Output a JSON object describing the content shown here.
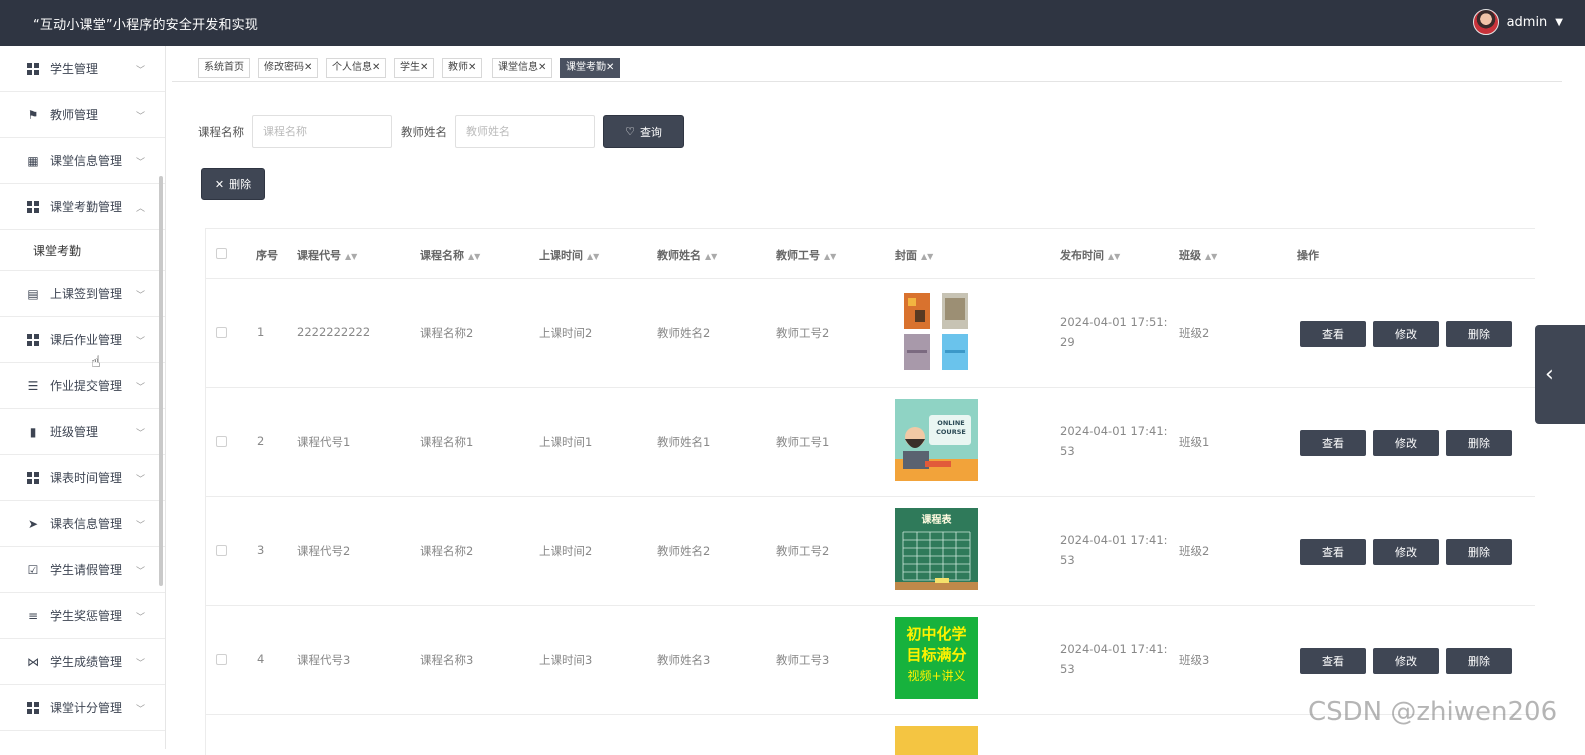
{
  "header": {
    "title": "“互动小课堂”小程序的安全开发和实现",
    "username": "admin"
  },
  "sidebar": {
    "items": [
      {
        "label": "学生管理"
      },
      {
        "label": "教师管理"
      },
      {
        "label": "课堂信息管理"
      },
      {
        "label": "课堂考勤管理"
      },
      {
        "label": "上课签到管理"
      },
      {
        "label": "课后作业管理"
      },
      {
        "label": "作业提交管理"
      },
      {
        "label": "班级管理"
      },
      {
        "label": "课表时间管理"
      },
      {
        "label": "课表信息管理"
      },
      {
        "label": "学生请假管理"
      },
      {
        "label": "学生奖惩管理"
      },
      {
        "label": "学生成绩管理"
      },
      {
        "label": "课堂计分管理"
      }
    ],
    "submenu": {
      "label": "课堂考勤"
    }
  },
  "tabs": [
    {
      "label": "系统首页"
    },
    {
      "label": "修改密码"
    },
    {
      "label": "个人信息"
    },
    {
      "label": "学生"
    },
    {
      "label": "教师"
    },
    {
      "label": "课堂信息"
    },
    {
      "label": "课堂考勤"
    }
  ],
  "search": {
    "course_label": "课程名称",
    "course_placeholder": "课程名称",
    "teacher_label": "教师姓名",
    "teacher_placeholder": "教师姓名",
    "query_label": "查询",
    "delete_label": "删除"
  },
  "table": {
    "headers": {
      "index": "序号",
      "code": "课程代号",
      "name": "课程名称",
      "time": "上课时间",
      "teacher": "教师姓名",
      "teacher_no": "教师工号",
      "cover": "封面",
      "publish": "发布时间",
      "class": "班级",
      "ops": "操作"
    },
    "rows": [
      {
        "index": "1",
        "code": "2222222222",
        "name": "课程名称2",
        "time": "上课时间2",
        "teacher": "教师姓名2",
        "teacher_no": "教师工号2",
        "publish_line1": "2024-04-01 17:51:",
        "publish_line2": "29",
        "class": "班级2"
      },
      {
        "index": "2",
        "code": "课程代号1",
        "name": "课程名称1",
        "time": "上课时间1",
        "teacher": "教师姓名1",
        "teacher_no": "教师工号1",
        "publish_line1": "2024-04-01 17:41:",
        "publish_line2": "53",
        "class": "班级1"
      },
      {
        "index": "3",
        "code": "课程代号2",
        "name": "课程名称2",
        "time": "上课时间2",
        "teacher": "教师姓名2",
        "teacher_no": "教师工号2",
        "publish_line1": "2024-04-01 17:41:",
        "publish_line2": "53",
        "class": "班级2"
      },
      {
        "index": "4",
        "code": "课程代号3",
        "name": "课程名称3",
        "time": "上课时间3",
        "teacher": "教师姓名3",
        "teacher_no": "教师工号3",
        "publish_line1": "2024-04-01 17:41:",
        "publish_line2": "53",
        "class": "班级3"
      }
    ],
    "actions": {
      "view": "查看",
      "edit": "修改",
      "delete": "删除"
    }
  },
  "covers": {
    "online_line1": "ONLINE",
    "online_line2": "COURSE",
    "schedule_title": "课程表",
    "chem_line1": "初中化学",
    "chem_line2": "目标满分",
    "chem_line3": "视频+讲义"
  },
  "watermark": "CSDN @zhiwen206",
  "colors": {
    "header_bg": "#2f3542",
    "button_bg": "#3f4654",
    "active_tab": "#4a5160"
  }
}
